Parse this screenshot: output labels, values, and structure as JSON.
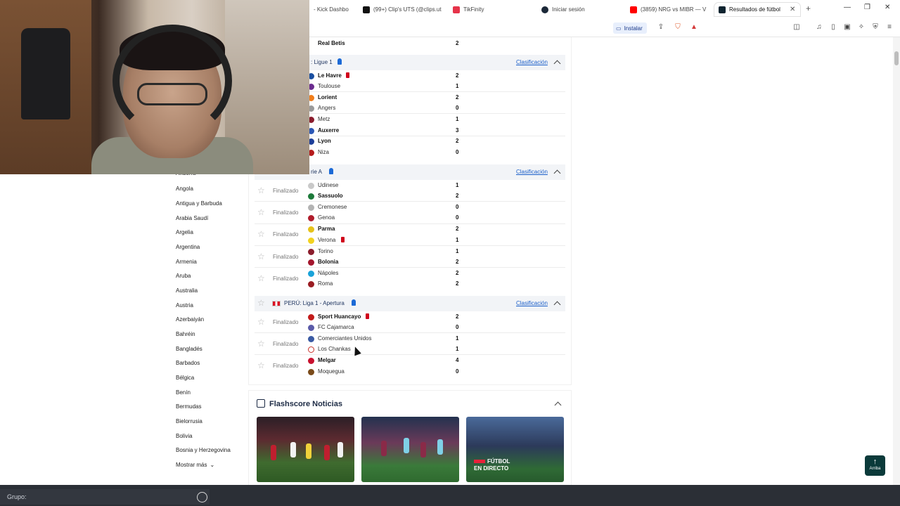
{
  "browser": {
    "tabs": [
      {
        "label": "- Kick Dashbo",
        "active": false
      },
      {
        "label": "(99+) Clip's UTS (@clips.ut",
        "active": false
      },
      {
        "label": "TikFinity",
        "active": false
      },
      {
        "label": "Iniciar sesión",
        "active": false
      },
      {
        "label": "(3859) NRG vs MIBR — V",
        "active": false
      },
      {
        "label": "Resultados de fútbol",
        "active": true
      }
    ],
    "install_label": "Instalar"
  },
  "sidebar": {
    "countries": [
      "Andorra",
      "Angola",
      "Antigua y Barbuda",
      "Arabia Saudí",
      "Argelia",
      "Argentina",
      "Armenia",
      "Aruba",
      "Australia",
      "Austria",
      "Azerbaiyán",
      "Bahréin",
      "Bangladés",
      "Barbados",
      "Bélgica",
      "Benín",
      "Bermudas",
      "Bielorrusia",
      "Bolivia",
      "Bosnia y Herzegovina"
    ],
    "more_label": "Mostrar más"
  },
  "matches": {
    "top_row": {
      "team": "Real Betis",
      "score": "2"
    },
    "ligue1": {
      "name": ": Ligue 1",
      "standings_label": "Clasificación",
      "games": [
        {
          "home": "Le Havre",
          "home_score": "2",
          "away": "Toulouse",
          "away_score": "1"
        },
        {
          "home": "Lorient",
          "home_score": "2",
          "away": "Angers",
          "away_score": "0"
        },
        {
          "home": "Metz",
          "home_score": "1",
          "away": "Auxerre",
          "away_score": "3"
        },
        {
          "home": "Lyon",
          "home_score": "2",
          "away": "Niza",
          "away_score": "0"
        }
      ]
    },
    "seriea": {
      "name": "rie A",
      "standings_label": "Clasificación",
      "status": "Finalizado",
      "games": [
        {
          "home": "Udinese",
          "home_score": "1",
          "away": "Sassuolo",
          "away_score": "2"
        },
        {
          "home": "Cremonese",
          "home_score": "0",
          "away": "Genoa",
          "away_score": "0"
        },
        {
          "home": "Parma",
          "home_score": "2",
          "away": "Verona",
          "away_score": "1"
        },
        {
          "home": "Torino",
          "home_score": "1",
          "away": "Bolonia",
          "away_score": "2"
        },
        {
          "home": "Nápoles",
          "home_score": "2",
          "away": "Roma",
          "away_score": "2"
        }
      ]
    },
    "peru": {
      "name": "PERÚ: Liga 1 - Apertura",
      "standings_label": "Clasificación",
      "status": "Finalizado",
      "games": [
        {
          "home": "Sport Huancayo",
          "home_score": "2",
          "away": "FC Cajamarca",
          "away_score": "0"
        },
        {
          "home": "Comerciantes Unidos",
          "home_score": "1",
          "away": "Los Chankas",
          "away_score": "1"
        },
        {
          "home": "Melgar",
          "home_score": "4",
          "away": "Moquegua",
          "away_score": "0"
        }
      ]
    }
  },
  "news": {
    "title": "Flashscore Noticias",
    "live_tag_line1": "FÚTBOL",
    "live_tag_line2": "EN DIRECTO"
  },
  "totop_label": "Arriba",
  "groupbar": {
    "label": "Grupo:"
  },
  "colors": {
    "accent": "#1b5fc9",
    "pin": "#1c6ad6",
    "red_card": "#d0021b"
  }
}
